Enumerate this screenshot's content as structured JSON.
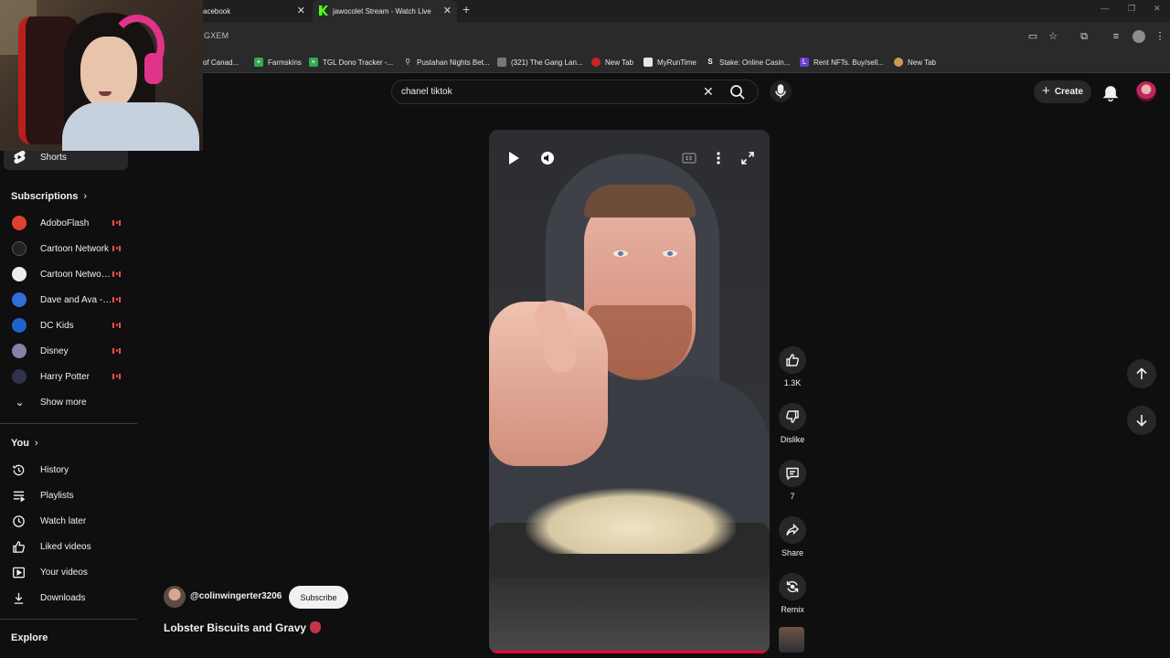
{
  "browser": {
    "tabs": [
      {
        "label": "acebook"
      },
      {
        "label": "jawocolet Stream - Watch Live"
      }
    ],
    "new_tab_symbol": "+",
    "address": "GXEM",
    "bookmarks": [
      {
        "label": "of Canad...",
        "icon": "maple-leaf-icon"
      },
      {
        "label": "Farmskins",
        "icon": "farmskins-icon"
      },
      {
        "label": "TGL Dono Tracker -...",
        "icon": "sheets-icon"
      },
      {
        "label": "Pustahan Nights Bet...",
        "icon": "bookmark-icon"
      },
      {
        "label": "(321) The Gang Lan...",
        "icon": "page-icon"
      },
      {
        "label": "New Tab",
        "icon": "new-tab-icon"
      },
      {
        "label": "MyRunTime",
        "icon": "myruntime-icon"
      },
      {
        "label": "Stake: Online Casin...",
        "icon": "stake-icon"
      },
      {
        "label": "Rent NFTs. Buy/sell...",
        "icon": "nft-icon"
      },
      {
        "label": "New Tab",
        "icon": "new-tab-icon"
      }
    ]
  },
  "sidebar": {
    "shorts_label": "Shorts",
    "subscriptions_heading": "Subscriptions",
    "subscriptions": [
      {
        "label": "AdoboFlash",
        "color": "#e0412f"
      },
      {
        "label": "Cartoon Network",
        "color": "#222222"
      },
      {
        "label": "Cartoon Network...",
        "color": "#ececec"
      },
      {
        "label": "Dave and Ava - N...",
        "color": "#2f6fd6"
      },
      {
        "label": "DC Kids",
        "color": "#1f63c9"
      },
      {
        "label": "Disney",
        "color": "#8a7fa6"
      },
      {
        "label": "Harry Potter",
        "color": "#30324a"
      }
    ],
    "show_more": "Show more",
    "you_heading": "You",
    "you_items": [
      {
        "label": "History",
        "icon": "history-icon"
      },
      {
        "label": "Playlists",
        "icon": "playlists-icon"
      },
      {
        "label": "Watch later",
        "icon": "watch-later-icon"
      },
      {
        "label": "Liked videos",
        "icon": "liked-videos-icon"
      },
      {
        "label": "Your videos",
        "icon": "your-videos-icon"
      },
      {
        "label": "Downloads",
        "icon": "downloads-icon"
      }
    ],
    "explore_heading": "Explore"
  },
  "masthead": {
    "search_value": "chanel tiktok",
    "create_label": "Create"
  },
  "short": {
    "channel_handle": "@colinwingerter3206",
    "subscribe_label": "Subscribe",
    "title": "Lobster Biscuits and Gravy",
    "progress": 1.0
  },
  "actions": {
    "like_count": "1.3K",
    "dislike_label": "Dislike",
    "comments_count": "7",
    "share_label": "Share",
    "remix_label": "Remix"
  },
  "colors": {
    "accent": "#ff0033",
    "background": "#0f0f0f",
    "surface": "#272727"
  }
}
